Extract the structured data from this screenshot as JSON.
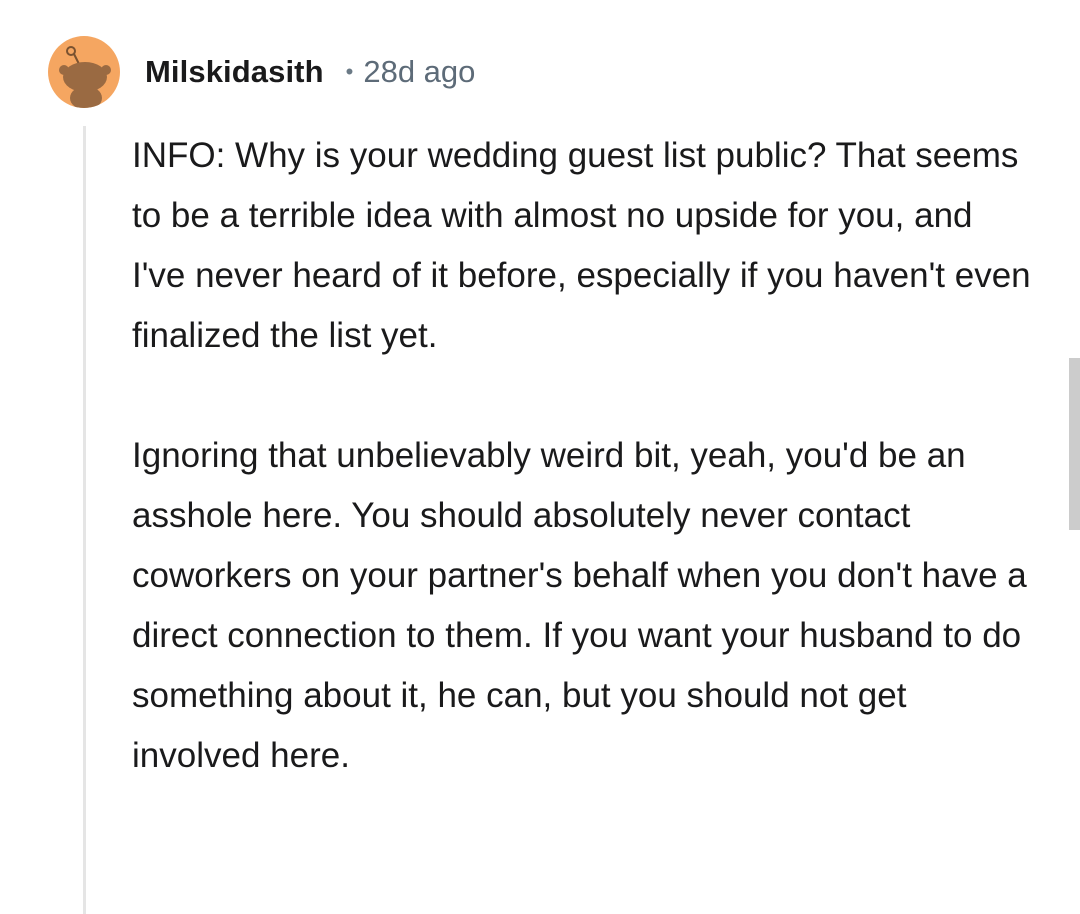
{
  "comment": {
    "avatar_icon": "reddit-snoo-avatar-icon",
    "avatar_color": "#f5a661",
    "username": "Milskidasith",
    "separator": "•",
    "timestamp": "28d ago",
    "paragraphs": [
      "INFO: Why is your wedding guest list public? That seems to be a terrible idea with almost no upside for you, and I've never heard of it before, especially if you haven't even finalized the list yet.",
      "Ignoring that unbelievably weird bit, yeah, you'd be an asshole here. You should absolutely never contact coworkers on your partner's behalf when you don't have a direct connection to them. If you want your husband to do something about it, he can, but you should not get involved here."
    ]
  }
}
